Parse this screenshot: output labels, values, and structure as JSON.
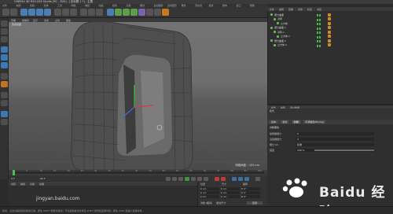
{
  "window": {
    "title": "CINEMA 4D R20.026 Studio (RC - R20) - [未标题 1 *] - 主要"
  },
  "menubar": {
    "items": [
      "文件",
      "编辑",
      "创建",
      "选择",
      "工具",
      "网格",
      "捕捉",
      "动画",
      "模拟",
      "渲染",
      "雕刻",
      "运动跟踪",
      "运动图形",
      "角色",
      "流水线",
      "插件",
      "脚本",
      "窗口",
      "帮助"
    ]
  },
  "viewport": {
    "menu": [
      "查看",
      "摄像机",
      "显示",
      "选项",
      "过滤",
      "面板"
    ],
    "label": "透视视图",
    "grid_distance": "网格间距 : 100 cm"
  },
  "timeline": {
    "ticks": [
      "0",
      "5",
      "10",
      "15",
      "20",
      "25",
      "30",
      "35",
      "40",
      "45",
      "50",
      "55",
      "60",
      "65",
      "70",
      "75",
      "80",
      "85",
      "90 F"
    ],
    "current_frame": "0 F",
    "end_frame": "90 F"
  },
  "material": {
    "menu": [
      "创建",
      "编辑",
      "功能",
      "纹理"
    ]
  },
  "coordinates": {
    "headers": [
      "位置",
      "尺寸",
      "旋转"
    ],
    "rows": [
      {
        "axis": "X",
        "pos": "0 cm",
        "size": "0 cm",
        "rot": "H 0°"
      },
      {
        "axis": "Y",
        "pos": "0 cm",
        "size": "0 cm",
        "rot": "P 0°"
      },
      {
        "axis": "Z",
        "pos": "0 cm",
        "size": "0 cm",
        "rot": "B 0°"
      }
    ],
    "mode": "对象 (相对)",
    "size_mode": "绝对尺寸",
    "apply": "应用"
  },
  "status": {
    "text": "移动：点击并拖动鼠标移动元素。按住 SHIFT 键量化移动；节点编辑模式时按住 SHIFT 键增加选择对象；按住 CTRL 键减少选择对象。"
  },
  "object_manager": {
    "menu": [
      "文件",
      "编辑",
      "查看",
      "对象",
      "标签",
      "书签"
    ],
    "objects": [
      {
        "name": "细分曲面",
        "indent": 0
      },
      {
        "name": "对称",
        "indent": 1
      },
      {
        "name": "立方体",
        "indent": 2
      },
      {
        "name": "细分曲面.1",
        "indent": 0
      },
      {
        "name": "对称.1",
        "indent": 1
      },
      {
        "name": "立方体.1",
        "indent": 2
      },
      {
        "name": "细分曲面.2",
        "indent": 0
      },
      {
        "name": "立方体.2",
        "indent": 1
      }
    ]
  },
  "attribute_manager": {
    "tabs": [
      "模式",
      "编辑",
      "用户数据"
    ],
    "mode_label": "模式",
    "subtabs": [
      "基本",
      "坐标",
      "对象",
      "平滑着色(Phong)"
    ],
    "active_subtab": "对象",
    "section": "对象属性",
    "rows": [
      {
        "label": "编辑器细分",
        "value": "2"
      },
      {
        "label": "渲染器细分",
        "value": "3"
      },
      {
        "label": "细分 UV",
        "value": "标准"
      },
      {
        "label": "强度",
        "value": "100 %"
      }
    ],
    "slider_fraction": 1.0
  },
  "watermark": {
    "text": "Baidu 经验",
    "url": "jingyan.baidu.com"
  },
  "colors": {
    "accent_green": "#47c14f",
    "object_icon": "#6bb657",
    "tag_orange": "#d08a28"
  }
}
